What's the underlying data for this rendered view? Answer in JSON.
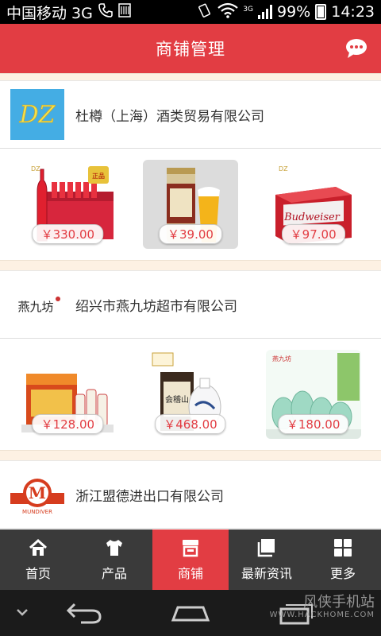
{
  "status_bar": {
    "carrier": "中国移动 3G",
    "network": "3G",
    "battery": "99%",
    "time": "14:23"
  },
  "header": {
    "title": "商铺管理",
    "icon": "chat-icon"
  },
  "stores": [
    {
      "name": "杜樽（上海）酒类贸易有限公司",
      "logo_text": "DZ",
      "products": [
        {
          "price": "￥330.00",
          "image": "red-beer-bottles"
        },
        {
          "price": "￥39.00",
          "image": "beer-can-and-glass"
        },
        {
          "price": "￥97.00",
          "image": "budweiser-pack"
        }
      ]
    },
    {
      "name": "绍兴市燕九坊超市有限公司",
      "logo_text": "燕九坊",
      "products": [
        {
          "price": "￥128.00",
          "image": "yellow-wine-gift-set"
        },
        {
          "price": "￥468.00",
          "image": "porcelain-wine-jar"
        },
        {
          "price": "￥180.00",
          "image": "celadon-bottles"
        }
      ]
    },
    {
      "name": "浙江盟德进出口有限公司",
      "logo_text": "M",
      "logo_caption": "MUNDIVER",
      "products": []
    }
  ],
  "tabs": [
    {
      "label": "首页",
      "icon": "home-icon",
      "active": false
    },
    {
      "label": "产品",
      "icon": "shirt-icon",
      "active": false
    },
    {
      "label": "商铺",
      "icon": "shop-icon",
      "active": true
    },
    {
      "label": "最新资讯",
      "icon": "news-icon",
      "active": false
    },
    {
      "label": "更多",
      "icon": "grid-icon",
      "active": false
    }
  ],
  "watermark": {
    "title": "风侠手机站",
    "url": "WWW.HACKHOME.COM"
  },
  "colors": {
    "accent": "#e23d43",
    "tabbar": "#3a3a3a",
    "navbar": "#1b1b1b"
  }
}
